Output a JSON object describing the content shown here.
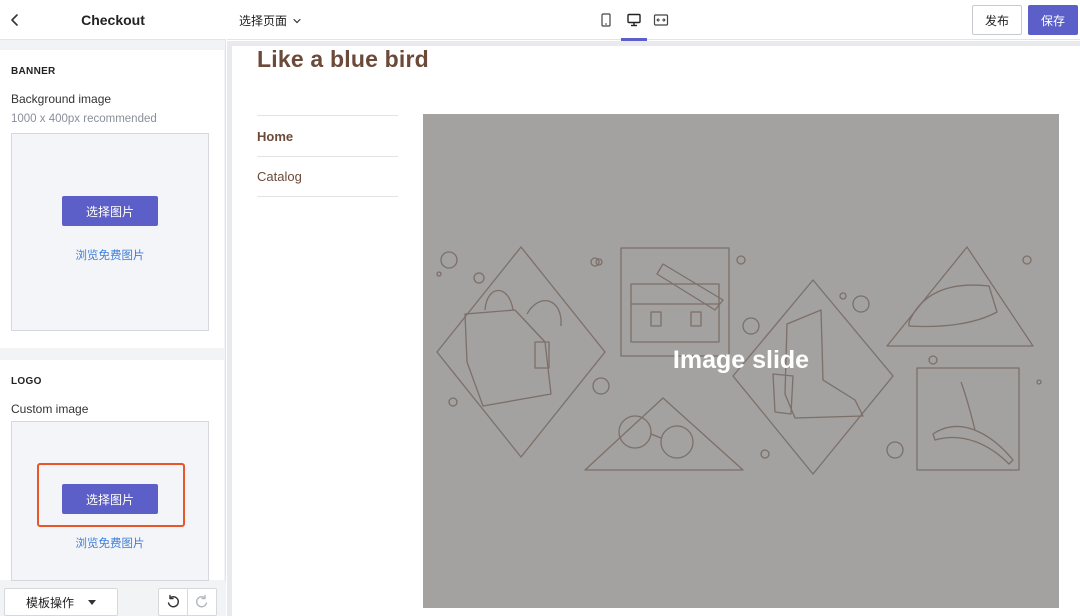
{
  "sidebar": {
    "title": "Checkout",
    "banner": {
      "section_title": "BANNER",
      "field_label": "Background image",
      "hint": "1000 x 400px recommended",
      "choose_label": "选择图片",
      "free_link": "浏览免费图片"
    },
    "logo": {
      "section_title": "LOGO",
      "field_label": "Custom image",
      "choose_label": "选择图片",
      "free_link": "浏览免费图片"
    },
    "footer": {
      "template_label": "模板操作"
    }
  },
  "topbar": {
    "page_select": "选择页面",
    "devices": [
      "mobile-icon",
      "desktop-icon",
      "fullwidth-icon"
    ],
    "active_device": "desktop-icon",
    "publish_label": "发布",
    "save_label": "保存"
  },
  "preview": {
    "store_title": "Like a blue bird",
    "nav": [
      "Home",
      "Catalog"
    ],
    "slide_caption": "Image slide"
  },
  "colors": {
    "accent": "#5b5fc7",
    "link": "#3d7fd9",
    "highlight": "#e8562a",
    "store_text": "#6b4a3a",
    "slide_bg": "#a3a2a0"
  }
}
